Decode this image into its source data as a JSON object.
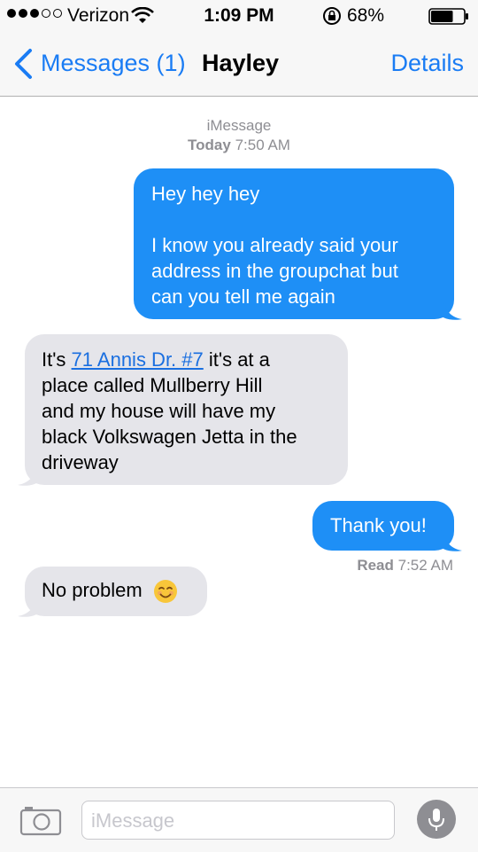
{
  "status_bar": {
    "carrier": "Verizon",
    "time": "1:09 PM",
    "battery": "68%",
    "battery_level": 0.68,
    "signal_bars_filled": 3,
    "signal_bars_total": 5
  },
  "nav": {
    "back_label": "Messages (1)",
    "title": "Hayley",
    "details_label": "Details"
  },
  "conversation": {
    "service": "iMessage",
    "date_label": "Today",
    "date_time": "7:50 AM",
    "messages": [
      {
        "direction": "outgoing",
        "lines": [
          "Hey hey hey",
          "",
          "I know you already said your",
          "address in the groupchat but",
          "can you tell me again"
        ]
      },
      {
        "direction": "incoming",
        "prefix": "It's ",
        "link": "71 Annis Dr. #7",
        "suffix": " it's at a",
        "lines": [
          "place called Mullberry Hill",
          "and my house will have my",
          "black Volkswagen Jetta in the",
          "driveway"
        ]
      },
      {
        "direction": "outgoing",
        "text": "Thank you!"
      },
      {
        "direction": "incoming",
        "text": "No problem",
        "emoji": "smiling-face-icon"
      }
    ],
    "receipt_label": "Read",
    "receipt_time": "7:52 AM"
  },
  "input": {
    "placeholder": "iMessage"
  },
  "colors": {
    "accent": "#1a7cf4",
    "outgoing_bubble": "#1e8ff6",
    "incoming_bubble": "#e5e5ea",
    "meta_text": "#8e8e93"
  }
}
